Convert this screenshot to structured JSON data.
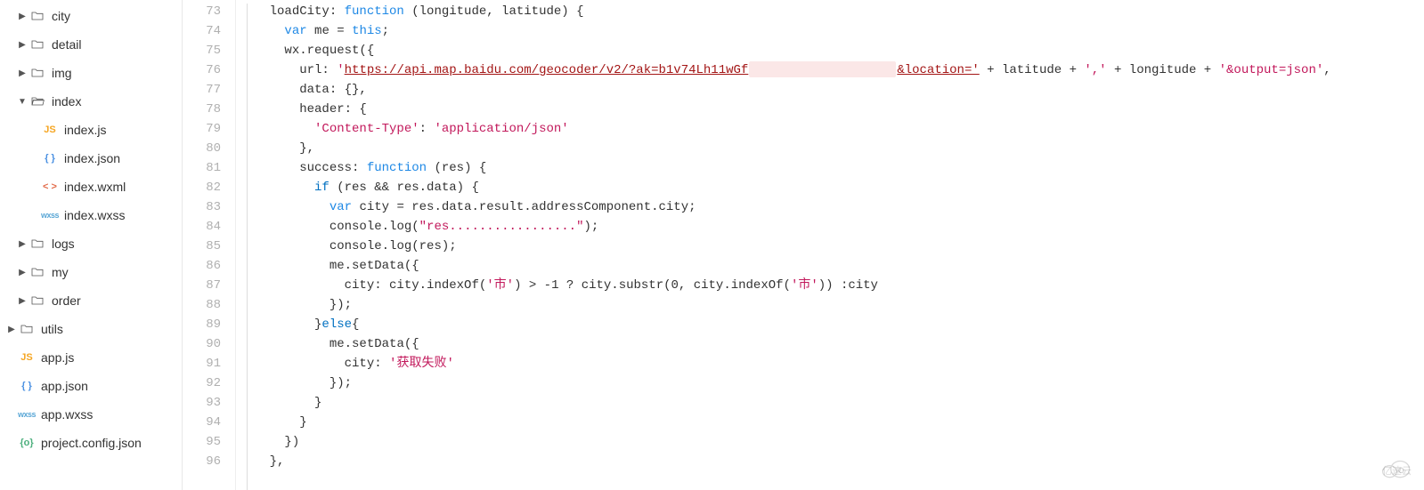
{
  "sidebar": {
    "items": [
      {
        "type": "folder",
        "label": "city",
        "expanded": false,
        "depth": 0
      },
      {
        "type": "folder",
        "label": "detail",
        "expanded": false,
        "depth": 0
      },
      {
        "type": "folder",
        "label": "img",
        "expanded": false,
        "depth": 0
      },
      {
        "type": "folder",
        "label": "index",
        "expanded": true,
        "depth": 0
      },
      {
        "type": "js",
        "label": "index.js",
        "depth": 1
      },
      {
        "type": "json",
        "label": "index.json",
        "depth": 1
      },
      {
        "type": "wxml",
        "label": "index.wxml",
        "depth": 1
      },
      {
        "type": "wxss",
        "label": "index.wxss",
        "depth": 1
      },
      {
        "type": "folder",
        "label": "logs",
        "expanded": false,
        "depth": 0
      },
      {
        "type": "folder",
        "label": "my",
        "expanded": false,
        "depth": 0
      },
      {
        "type": "folder",
        "label": "order",
        "expanded": false,
        "depth": 0
      },
      {
        "type": "folder",
        "label": "utils",
        "expanded": false,
        "depth": -1
      },
      {
        "type": "js",
        "label": "app.js",
        "depth": -1
      },
      {
        "type": "json",
        "label": "app.json",
        "depth": -1
      },
      {
        "type": "wxss",
        "label": "app.wxss",
        "depth": -1
      },
      {
        "type": "config",
        "label": "project.config.json",
        "depth": -1
      }
    ]
  },
  "gutter": {
    "start": 73,
    "end": 96
  },
  "code": {
    "l73": {
      "a": "loadCity: ",
      "b": "function",
      "c": " (longitude, latitude) {"
    },
    "l74": {
      "a": "var",
      "b": " me = ",
      "c": "this",
      "d": ";"
    },
    "l75": {
      "a": "wx.request({"
    },
    "l76": {
      "a": "url: ",
      "b": "'",
      "c": "https://api.map.baidu.com/geocoder/v2/?ak=b1v74Lh11wGf",
      "d": "&location='",
      "e": " + latitude + ",
      "f": "','",
      "g": " + longitude + ",
      "h": "'&output=json'",
      "i": ","
    },
    "l77": {
      "a": "data: {},"
    },
    "l78": {
      "a": "header: {"
    },
    "l79": {
      "a": "'Content-Type'",
      "b": ": ",
      "c": "'application/json'"
    },
    "l80": {
      "a": "},"
    },
    "l81": {
      "a": "success: ",
      "b": "function",
      "c": " (res) {"
    },
    "l82": {
      "a": "if",
      "b": " (res && res.data) {"
    },
    "l83": {
      "a": "var",
      "b": " city = res.data.result.addressComponent.city;"
    },
    "l84": {
      "a": "console.log(",
      "b": "\"res.................\"",
      "c": ");"
    },
    "l85": {
      "a": "console.log(res);"
    },
    "l86": {
      "a": "me.setData({"
    },
    "l87": {
      "a": "city: city.indexOf(",
      "b": "'市'",
      "c": ") > -1 ? city.substr(0, city.indexOf(",
      "d": "'市'",
      "e": ")) :city"
    },
    "l88": {
      "a": "});"
    },
    "l89": {
      "a": "}",
      "b": "else",
      "c": "{"
    },
    "l90": {
      "a": "me.setData({"
    },
    "l91": {
      "a": "city: ",
      "b": "'获取失败'"
    },
    "l92": {
      "a": "});"
    },
    "l93": {
      "a": "}"
    },
    "l94": {
      "a": "}"
    },
    "l95": {
      "a": "})"
    },
    "l96": {
      "a": "},"
    }
  },
  "icons": {
    "js": "JS",
    "json": "{ }",
    "wxml": "< >",
    "wxss": "wxss",
    "config": "{o}"
  },
  "watermark": "亿速云"
}
